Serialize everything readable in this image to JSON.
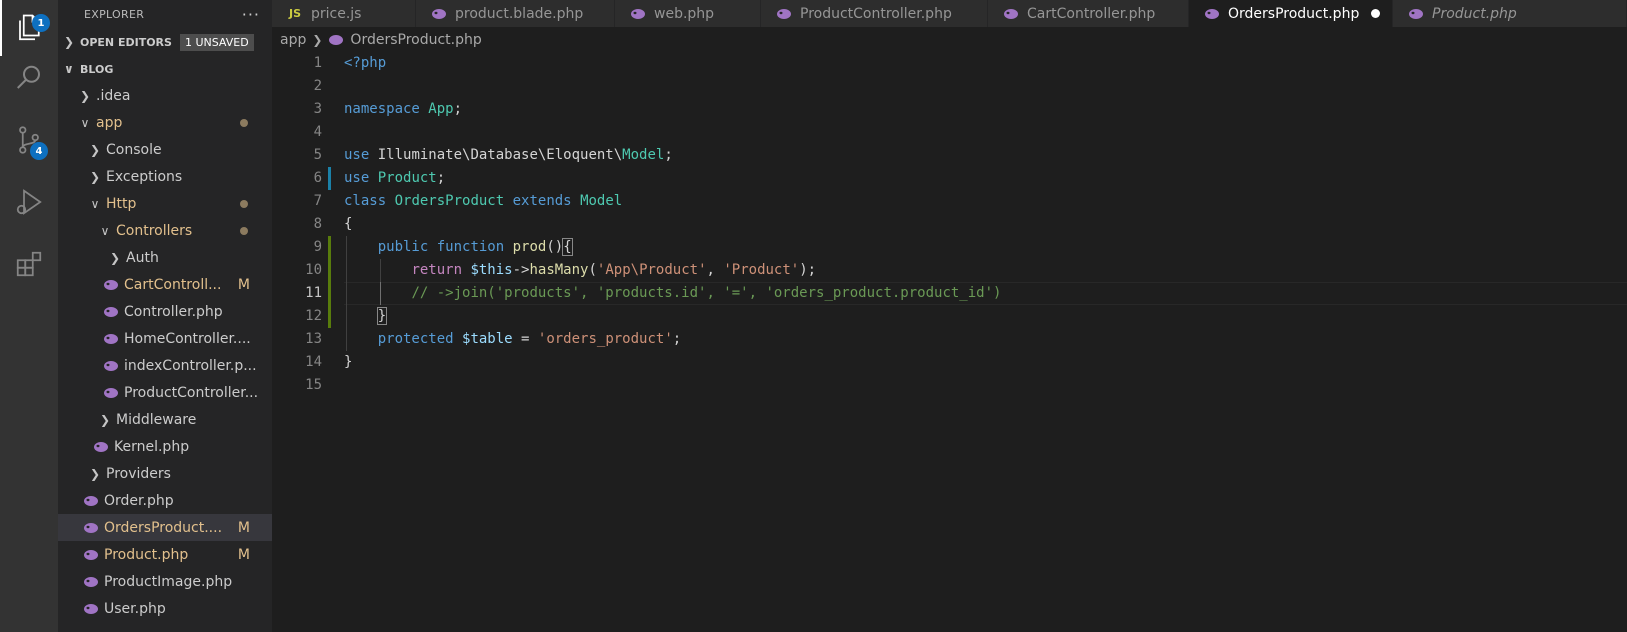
{
  "activity": {
    "explorer_badge": "1",
    "scm_badge": "4"
  },
  "sidebar": {
    "title": "EXPLORER",
    "more": "···",
    "open_editors": "OPEN EDITORS",
    "unsaved": "1 UNSAVED",
    "project": "BLOG",
    "items": [
      {
        "label": ".idea",
        "type": "folder",
        "open": false,
        "depth": 0
      },
      {
        "label": "app",
        "type": "folder",
        "open": true,
        "depth": 0,
        "status": "dot"
      },
      {
        "label": "Console",
        "type": "folder",
        "open": false,
        "depth": 1
      },
      {
        "label": "Exceptions",
        "type": "folder",
        "open": false,
        "depth": 1
      },
      {
        "label": "Http",
        "type": "folder",
        "open": true,
        "depth": 1,
        "status": "dot"
      },
      {
        "label": "Controllers",
        "type": "folder",
        "open": true,
        "depth": 2,
        "status": "dot"
      },
      {
        "label": "Auth",
        "type": "folder",
        "open": false,
        "depth": 3
      },
      {
        "label": "CartControll...",
        "type": "php",
        "depth": 3,
        "status": "M"
      },
      {
        "label": "Controller.php",
        "type": "php",
        "depth": 3
      },
      {
        "label": "HomeController....",
        "type": "php",
        "depth": 3
      },
      {
        "label": "indexController.p...",
        "type": "php",
        "depth": 3
      },
      {
        "label": "ProductController...",
        "type": "php",
        "depth": 3
      },
      {
        "label": "Middleware",
        "type": "folder",
        "open": false,
        "depth": 2
      },
      {
        "label": "Kernel.php",
        "type": "php",
        "depth": 2
      },
      {
        "label": "Providers",
        "type": "folder",
        "open": false,
        "depth": 1
      },
      {
        "label": "Order.php",
        "type": "php",
        "depth": 1
      },
      {
        "label": "OrdersProduct....",
        "type": "php",
        "depth": 1,
        "status": "M",
        "selected": true
      },
      {
        "label": "Product.php",
        "type": "php",
        "depth": 1,
        "status": "M"
      },
      {
        "label": "ProductImage.php",
        "type": "php",
        "depth": 1
      },
      {
        "label": "User.php",
        "type": "php",
        "depth": 1
      }
    ]
  },
  "tabs": [
    {
      "label": "price.js",
      "icon": "js",
      "icon_text": "JS",
      "width": 144
    },
    {
      "label": "product.blade.php",
      "icon": "php",
      "width": 199
    },
    {
      "label": "web.php",
      "icon": "php",
      "width": 146
    },
    {
      "label": "ProductController.php",
      "icon": "php",
      "width": 227
    },
    {
      "label": "CartController.php",
      "icon": "php",
      "width": 201
    },
    {
      "label": "OrdersProduct.php",
      "icon": "php",
      "active": true,
      "dirty": true,
      "width": 204
    },
    {
      "label": "Product.php",
      "icon": "php",
      "italic": true,
      "width": 234
    }
  ],
  "breadcrumb": {
    "folder": "app",
    "file": "OrdersProduct.php"
  },
  "editor": {
    "current_line": 11,
    "lines": [
      {
        "n": "1",
        "tokens": [
          [
            "tag",
            "<?php"
          ]
        ]
      },
      {
        "n": "2",
        "tokens": []
      },
      {
        "n": "3",
        "tokens": [
          [
            "kw",
            "namespace"
          ],
          [
            "plain",
            " "
          ],
          [
            "type",
            "App"
          ],
          [
            "plain",
            ";"
          ]
        ]
      },
      {
        "n": "4",
        "tokens": []
      },
      {
        "n": "5",
        "tokens": [
          [
            "kw",
            "use"
          ],
          [
            "plain",
            " Illuminate\\Database\\Eloquent\\"
          ],
          [
            "type",
            "Model"
          ],
          [
            "plain",
            ";"
          ]
        ],
        "mark": null
      },
      {
        "n": "6",
        "tokens": [
          [
            "kw",
            "use"
          ],
          [
            "plain",
            " "
          ],
          [
            "type",
            "Product"
          ],
          [
            "plain",
            ";"
          ]
        ],
        "mark": "blue"
      },
      {
        "n": "7",
        "tokens": [
          [
            "kw",
            "class"
          ],
          [
            "plain",
            " "
          ],
          [
            "type",
            "OrdersProduct"
          ],
          [
            "plain",
            " "
          ],
          [
            "kw",
            "extends"
          ],
          [
            "plain",
            " "
          ],
          [
            "type",
            "Model"
          ]
        ]
      },
      {
        "n": "8",
        "tokens": [
          [
            "plain",
            "{"
          ]
        ]
      },
      {
        "n": "9",
        "tokens": [
          [
            "plain",
            "    "
          ],
          [
            "kw",
            "public"
          ],
          [
            "plain",
            " "
          ],
          [
            "kw",
            "function"
          ],
          [
            "plain",
            " "
          ],
          [
            "fn",
            "prod"
          ],
          [
            "plain",
            "()"
          ],
          [
            "bracket",
            "{"
          ]
        ],
        "mark": "green"
      },
      {
        "n": "10",
        "tokens": [
          [
            "plain",
            "        "
          ],
          [
            "ctrl",
            "return"
          ],
          [
            "plain",
            " "
          ],
          [
            "var",
            "$this"
          ],
          [
            "plain",
            "->"
          ],
          [
            "fn",
            "hasMany"
          ],
          [
            "plain",
            "("
          ],
          [
            "str",
            "'App\\Product'"
          ],
          [
            "plain",
            ", "
          ],
          [
            "str",
            "'Product'"
          ],
          [
            "plain",
            ");"
          ]
        ],
        "mark": "green"
      },
      {
        "n": "11",
        "tokens": [
          [
            "plain",
            "        "
          ],
          [
            "cm",
            "// ->join('products', 'products.id', '=', 'orders_product.product_id')"
          ]
        ],
        "mark": "green"
      },
      {
        "n": "12",
        "tokens": [
          [
            "plain",
            "    "
          ],
          [
            "bracket",
            "}"
          ]
        ],
        "mark": "green"
      },
      {
        "n": "13",
        "tokens": [
          [
            "plain",
            "    "
          ],
          [
            "kw",
            "protected"
          ],
          [
            "plain",
            " "
          ],
          [
            "var",
            "$table"
          ],
          [
            "plain",
            " = "
          ],
          [
            "str",
            "'orders_product'"
          ],
          [
            "plain",
            ";"
          ]
        ]
      },
      {
        "n": "14",
        "tokens": [
          [
            "plain",
            "}"
          ]
        ]
      },
      {
        "n": "15",
        "tokens": []
      }
    ]
  },
  "colors": {
    "accent": "#0e70c0",
    "php_icon": "#a074c4",
    "modified": "#e2c08d"
  }
}
